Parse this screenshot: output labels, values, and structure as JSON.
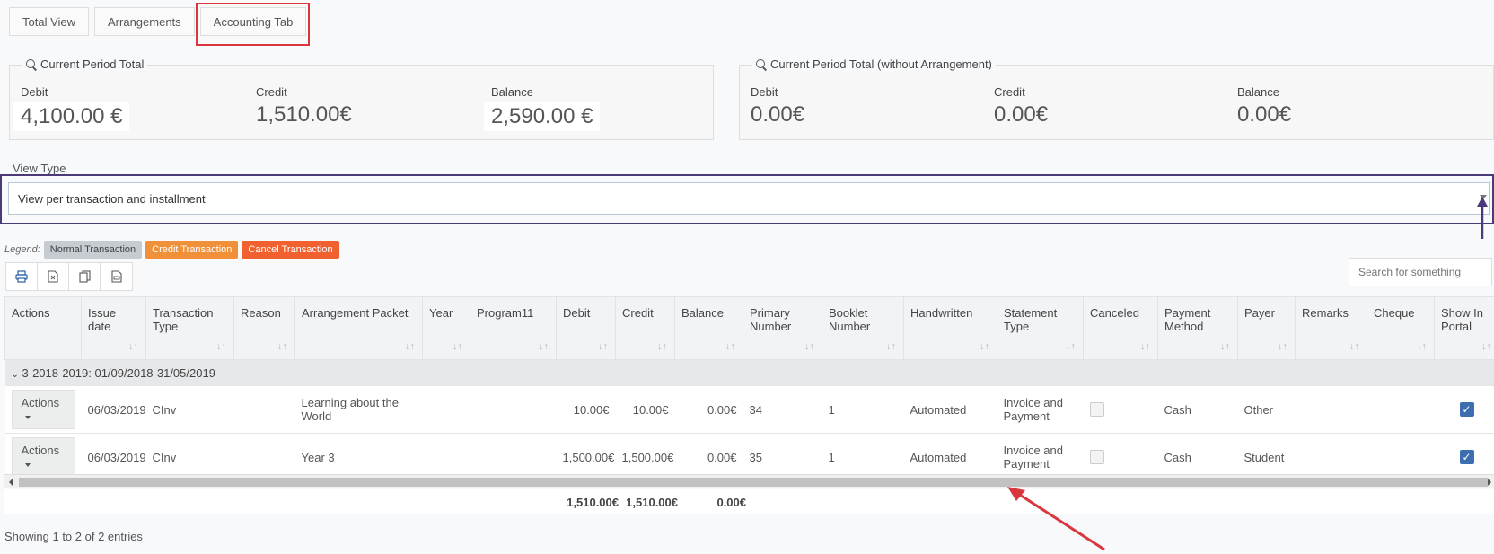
{
  "tabs": [
    {
      "label": "Total View"
    },
    {
      "label": "Arrangements"
    },
    {
      "label": "Accounting Tab"
    }
  ],
  "totals_left": {
    "title": "Current Period Total",
    "debit_label": "Debit",
    "debit": "4,100.00 €",
    "credit_label": "Credit",
    "credit": "1,510.00€",
    "balance_label": "Balance",
    "balance": "2,590.00 €"
  },
  "totals_right": {
    "title": "Current Period Total (without Arrangement)",
    "debit_label": "Debit",
    "debit": "0.00€",
    "credit_label": "Credit",
    "credit": "0.00€",
    "balance_label": "Balance",
    "balance": "0.00€"
  },
  "view_type": {
    "label": "View Type",
    "value": "View per transaction and installment"
  },
  "legend": {
    "label": "Legend:",
    "normal": "Normal Transaction",
    "credit": "Credit Transaction",
    "cancel": "Cancel Transaction"
  },
  "search": {
    "placeholder": "Search for something"
  },
  "table": {
    "headers": [
      "Actions",
      "Issue date",
      "Transaction Type",
      "Reason",
      "Arrangement Packet",
      "Year",
      "Program11",
      "Debit",
      "Credit",
      "Balance",
      "Primary Number",
      "Booklet Number",
      "Handwritten",
      "Statement Type",
      "Canceled",
      "Payment Method",
      "Payer",
      "Remarks",
      "Cheque",
      "Show In Portal"
    ],
    "group": "3-2018-2019: 01/09/2018-31/05/2019",
    "rows": [
      {
        "actions": "Actions",
        "issue_date": "06/03/2019",
        "type": "CInv",
        "reason": "",
        "packet": "Learning about the World",
        "year": "",
        "program": "",
        "debit": "10.00€",
        "credit": "10.00€",
        "balance": "0.00€",
        "primary": "34",
        "booklet": "1",
        "handwritten": "Automated",
        "statement": "Invoice and Payment",
        "method": "Cash",
        "payer": "Other",
        "remarks": "",
        "cheque": "",
        "show_in_portal": true
      },
      {
        "actions": "Actions",
        "issue_date": "06/03/2019",
        "type": "CInv",
        "reason": "",
        "packet": "Year 3",
        "year": "",
        "program": "",
        "debit": "1,500.00€",
        "credit": "1,500.00€",
        "balance": "0.00€",
        "primary": "35",
        "booklet": "1",
        "handwritten": "Automated",
        "statement": "Invoice and Payment",
        "method": "Cash",
        "payer": "Student",
        "remarks": "",
        "cheque": "",
        "show_in_portal": true
      }
    ],
    "totals": {
      "debit": "1,510.00€",
      "credit": "1,510.00€",
      "balance": "0.00€"
    }
  },
  "footer": {
    "showing": "Showing 1 to 2 of 2 entries"
  },
  "colors": {
    "highlight_red": "#d9363e",
    "highlight_purple": "#4a3a7a",
    "credit": "#f0913a",
    "cancel": "#f0612f",
    "checkbox": "#3d6fb0"
  }
}
